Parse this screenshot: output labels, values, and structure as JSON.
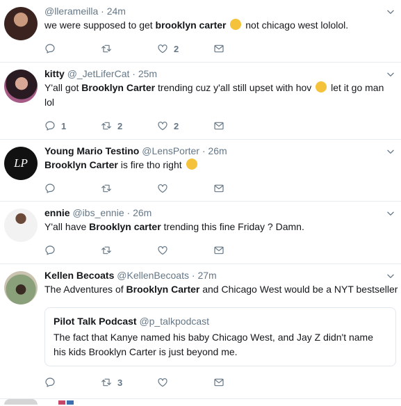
{
  "tweets": [
    {
      "name": "",
      "handle": "@llerameilla",
      "time": "24m",
      "text_parts": [
        "we were supposed to get ",
        "brooklyn carter",
        " ",
        " not chicago west lololol."
      ],
      "replies": "",
      "retweets": "",
      "likes": "2",
      "emoji": "rolling-eyes-emoji"
    },
    {
      "name": "kitty",
      "handle": "@_JetLiferCat",
      "time": "25m",
      "text_parts": [
        "Y'all got ",
        "Brooklyn Carter",
        " trending cuz y'all still upset with hov ",
        " let it go man lol"
      ],
      "replies": "1",
      "retweets": "2",
      "likes": "2",
      "emoji": "crying-emoji"
    },
    {
      "name": "Young Mario Testino",
      "handle": "@LensPorter",
      "time": "26m",
      "text_parts": [
        "",
        "Brooklyn Carter",
        " is fire tho right ",
        ""
      ],
      "replies": "",
      "retweets": "",
      "likes": "",
      "emoji": "neutral-face-emoji",
      "avatar_text": "LP"
    },
    {
      "name": "ennie",
      "handle": "@ibs_ennie",
      "time": "26m",
      "text_parts": [
        "Y'all have ",
        "Brooklyn carter",
        " trending this fine Friday ? Damn.",
        ""
      ],
      "replies": "",
      "retweets": "",
      "likes": ""
    },
    {
      "name": "Kellen Becoats",
      "handle": "@KellenBecoats",
      "time": "27m",
      "text_parts": [
        "The Adventures of ",
        "Brooklyn Carter",
        " and Chicago West would be a NYT bestseller",
        ""
      ],
      "replies": "",
      "retweets": "3",
      "likes": "",
      "quote": {
        "name": "Pilot Talk Podcast",
        "handle": "@p_talkpodcast",
        "text": "The fact that Kanye named his baby Chicago West, and Jay Z didn't name his kids Brooklyn Carter is just beyond me."
      }
    }
  ],
  "separator": "·",
  "colors": {
    "text": "#14171a",
    "muted": "#657786",
    "border": "#e6ecf0"
  }
}
